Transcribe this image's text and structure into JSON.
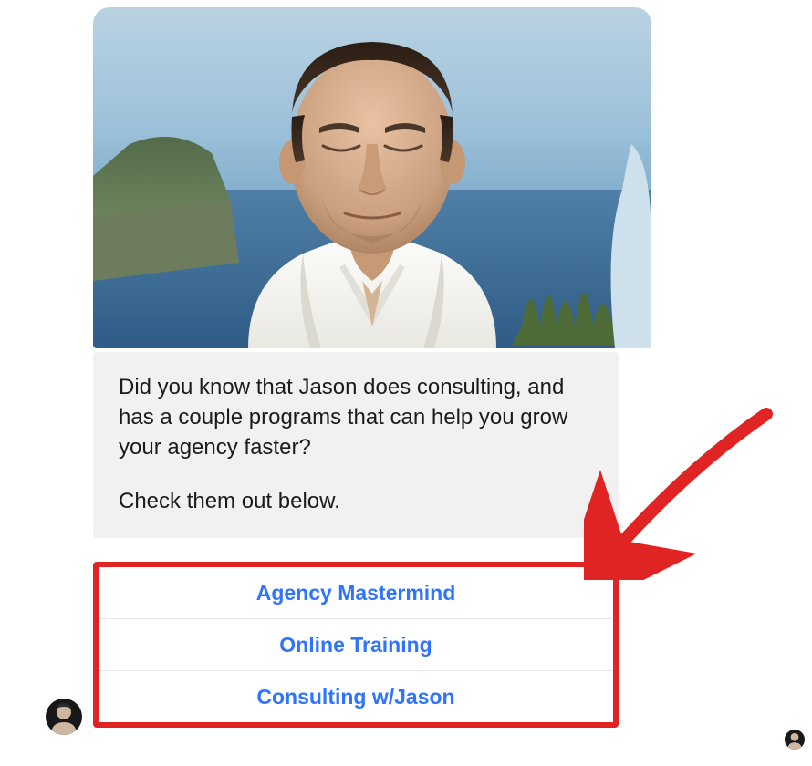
{
  "message": {
    "paragraph1": "Did you know that Jason does consulting, and has a couple programs that can help you grow your agency faster?",
    "paragraph2": "Check them out below."
  },
  "options": [
    {
      "label": "Agency Mastermind"
    },
    {
      "label": "Online Training"
    },
    {
      "label": "Consulting w/Jason"
    }
  ],
  "colors": {
    "highlight_border": "#e02424",
    "option_text": "#2f74ff",
    "arrow": "#e02424"
  }
}
